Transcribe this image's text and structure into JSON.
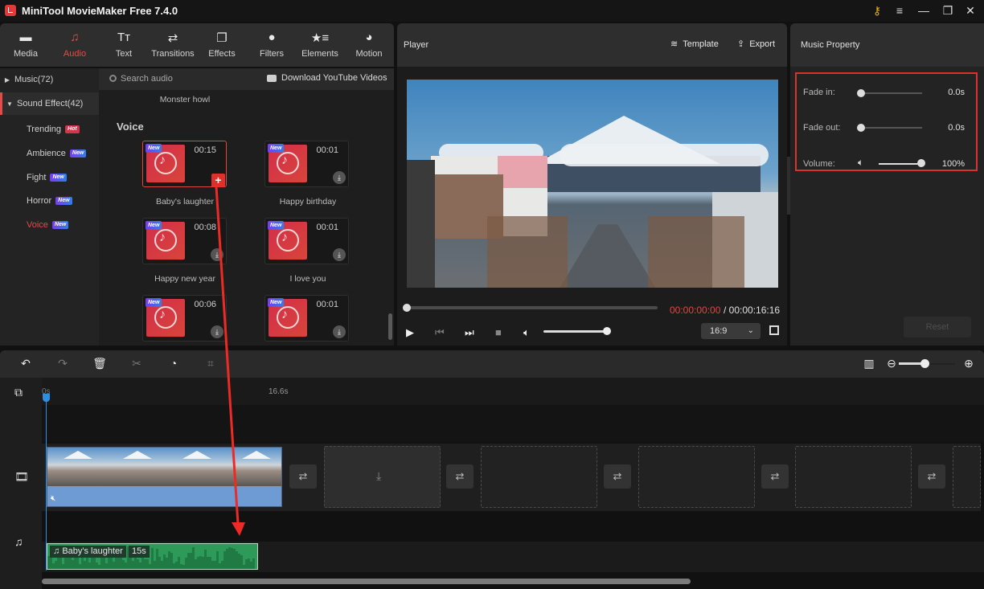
{
  "window": {
    "title": "MiniTool MovieMaker Free 7.4.0",
    "controls": [
      "key-icon",
      "menu-icon",
      "minimize-icon",
      "restore-icon",
      "close-icon"
    ]
  },
  "toolbar": {
    "tabs": [
      {
        "label": "Media",
        "icon": "folder-icon"
      },
      {
        "label": "Audio",
        "icon": "music-note-icon",
        "active": true
      },
      {
        "label": "Text",
        "icon": "text-icon"
      },
      {
        "label": "Transitions",
        "icon": "swap-arrows-icon"
      },
      {
        "label": "Effects",
        "icon": "layers-icon"
      },
      {
        "label": "Filters",
        "icon": "filter-circles-icon"
      },
      {
        "label": "Elements",
        "icon": "star-list-icon"
      },
      {
        "label": "Motion",
        "icon": "motion-circle-icon"
      }
    ]
  },
  "sidebar": {
    "music": "Music(72)",
    "sound_effect": "Sound Effect(42)",
    "items": [
      {
        "label": "Trending",
        "badge": "Hot"
      },
      {
        "label": "Ambience",
        "badge": "New"
      },
      {
        "label": "Fight",
        "badge": "New"
      },
      {
        "label": "Horror",
        "badge": "New"
      },
      {
        "label": "Voice",
        "badge": "New",
        "selected": true
      }
    ]
  },
  "library": {
    "search_placeholder": "Search audio",
    "download_label": "Download YouTube Videos",
    "prev_item_caption": "Monster howl",
    "section_title": "Voice",
    "new_tag": "New",
    "items": [
      {
        "duration": "00:15",
        "caption": "Baby's laughter",
        "action": "add"
      },
      {
        "duration": "00:01",
        "caption": "Happy birthday",
        "action": "download"
      },
      {
        "duration": "00:08",
        "caption": "Happy new year",
        "action": "download"
      },
      {
        "duration": "00:01",
        "caption": "I love you",
        "action": "download"
      },
      {
        "duration": "00:06",
        "caption": "",
        "action": "download"
      },
      {
        "duration": "00:01",
        "caption": "",
        "action": "download"
      }
    ]
  },
  "player": {
    "title": "Player",
    "template_label": "Template",
    "export_label": "Export",
    "current_time": "00:00:00:00",
    "total_time": "/ 00:00:16:16",
    "aspect_ratio": "16:9",
    "progress_fraction": 0.0,
    "volume_fraction": 1.0
  },
  "properties": {
    "title": "Music Property",
    "fade_in_label": "Fade in:",
    "fade_in_value": "0.0s",
    "fade_out_label": "Fade out:",
    "fade_out_value": "0.0s",
    "volume_label": "Volume:",
    "volume_value": "100%",
    "reset_label": "Reset",
    "highlight_color": "#e0302b"
  },
  "timeline": {
    "ruler_start": "0s",
    "ruler_mark": "16.6s",
    "zoom_fraction": 0.45,
    "audio_clip": {
      "name": "Baby's laughter",
      "duration": "15s"
    },
    "accent_color": "#2f8ee0",
    "audio_color": "#2e9a5a"
  }
}
